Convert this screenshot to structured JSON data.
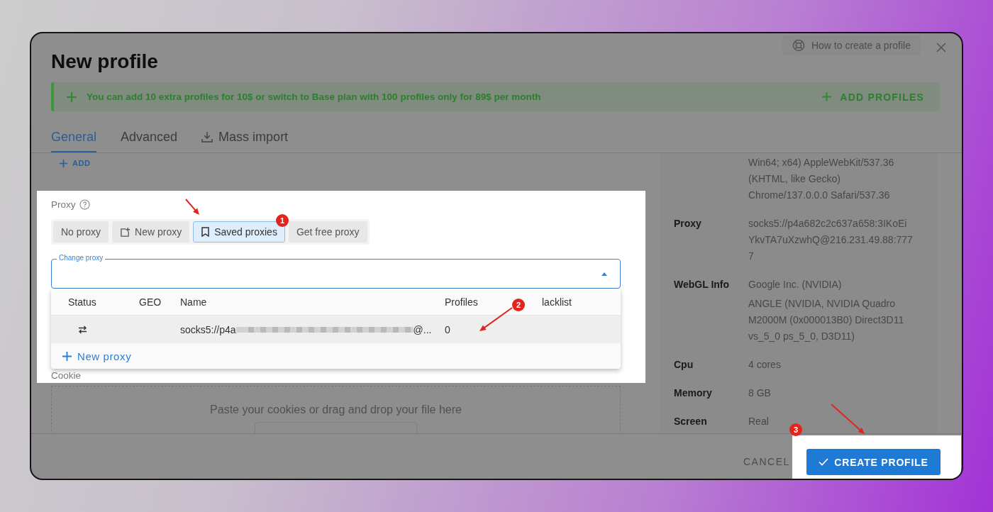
{
  "dialog": {
    "title": "New profile",
    "help_button": "How to create a profile"
  },
  "banner": {
    "text": "You can add 10 extra profiles for 10$ or switch to Base plan with 100 profiles only for 89$ per month",
    "action": "ADD PROFILES"
  },
  "tabs": [
    {
      "label": "General",
      "selected": true,
      "has_icon": false
    },
    {
      "label": "Advanced",
      "selected": false,
      "has_icon": false
    },
    {
      "label": "Mass import",
      "selected": false,
      "has_icon": true
    }
  ],
  "add_link": "ADD",
  "proxy": {
    "label": "Proxy",
    "modes": [
      {
        "label": "No proxy",
        "selected": false,
        "has_icon": false
      },
      {
        "label": "New proxy",
        "selected": false,
        "has_icon": true
      },
      {
        "label": "Saved proxies",
        "selected": true,
        "has_icon": true
      },
      {
        "label": "Get free proxy",
        "selected": false,
        "has_icon": false
      }
    ],
    "field_label": "Change proxy",
    "expanded": true,
    "menu": {
      "columns": [
        "Status",
        "GEO",
        "Name",
        "Profiles",
        "lacklist"
      ],
      "rows": [
        {
          "name_start": "socks5://p4a",
          "name_end": "@...",
          "profiles": "0",
          "selected": true
        }
      ],
      "new_proxy": "New proxy"
    }
  },
  "cookie": {
    "label": "Cookie",
    "drop_hint": "Paste your cookies or drag and drop your file here"
  },
  "summary": [
    {
      "values": [
        [
          "Win64; x64) AppleWebKit/537.36",
          "(KHTML, like Gecko)",
          "Chrome/137.0.0.0 Safari/537.36"
        ]
      ]
    },
    {
      "label": "Proxy",
      "values": [
        [
          "socks5://p4a682c2c637a658:3IKoEi",
          "YkvTA7uXzwhQ@216.231.49.88:777",
          "7"
        ]
      ]
    },
    {
      "label": "WebGL Info",
      "values": [
        [
          "Google Inc. (NVIDIA)"
        ],
        [
          "ANGLE (NVIDIA, NVIDIA Quadro",
          "M2000M (0x000013B0) Direct3D11",
          "vs_5_0 ps_5_0, D3D11)"
        ]
      ]
    },
    {
      "label": "Cpu",
      "values": [
        [
          "4 cores"
        ]
      ]
    },
    {
      "label": "Memory",
      "values": [
        [
          "8 GB"
        ]
      ]
    },
    {
      "label": "Screen",
      "values": [
        [
          "Real"
        ]
      ]
    }
  ],
  "footer": {
    "cancel": "CANCEL",
    "create": "CREATE PROFILE"
  },
  "annotations": [
    {
      "number": "1"
    },
    {
      "number": "2"
    },
    {
      "number": "3"
    }
  ]
}
